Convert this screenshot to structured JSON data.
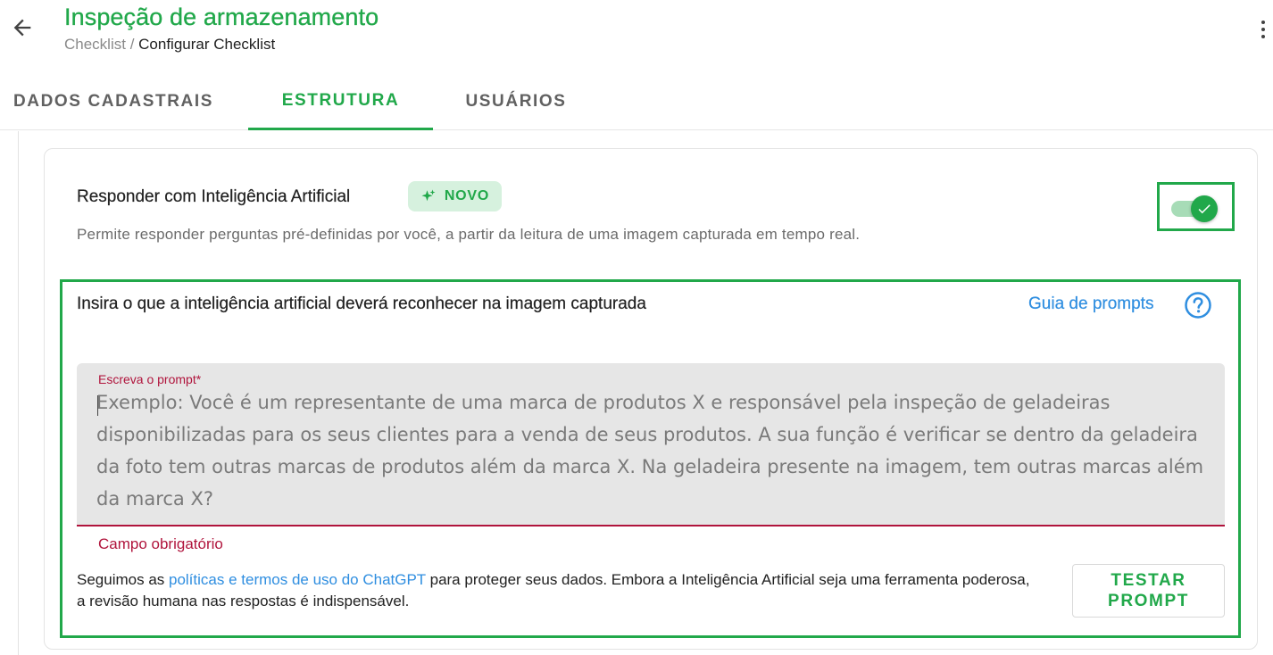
{
  "header": {
    "title": "Inspeção de armazenamento",
    "breadcrumb": {
      "parent": "Checklist",
      "separator": " / ",
      "current": "Configurar Checklist"
    },
    "back_icon": "arrow-left-icon",
    "menu_icon": "more-vertical-icon"
  },
  "tabs": [
    {
      "label": "DADOS CADASTRAIS",
      "active": false
    },
    {
      "label": "ESTRUTURA",
      "active": true
    },
    {
      "label": "USUÁRIOS",
      "active": false
    }
  ],
  "ai_section": {
    "title": "Responder com Inteligência Artificial",
    "badge": {
      "label": "NOVO",
      "icon": "sparkle-icon"
    },
    "description": "Permite responder perguntas pré-definidas por você, a partir da leitura de uma imagem capturada em tempo real.",
    "toggle_on": true
  },
  "prompt_section": {
    "heading": "Insira o que a inteligência artificial deverá reconhecer na imagem capturada",
    "guide_link": "Guia de prompts",
    "help_icon": "help-circle-icon",
    "field_label": "Escreva o prompt*",
    "value": "",
    "placeholder": "Exemplo: Você é um representante de uma marca de produtos X e responsável pela inspeção de geladeiras disponibilizadas para os seus clientes para a venda de seus produtos. A sua função é verificar se dentro da geladeira da foto tem outras marcas de produtos além da marca X. Na geladeira presente na imagem, tem outras marcas além da marca X?",
    "error": "Campo obrigatório",
    "disclaimer_before": "Seguimos as ",
    "disclaimer_link": "políticas e termos de uso do ChatGPT",
    "disclaimer_after": " para proteger seus dados. Embora a Inteligência Artificial seja uma ferramenta poderosa, a revisão humana nas respostas é indispensável.",
    "test_button": "TESTAR PROMPT"
  },
  "colors": {
    "primary": "#21a84a",
    "link": "#2f8ee0",
    "error": "#b0143c",
    "badge_bg": "#d6f1de"
  }
}
